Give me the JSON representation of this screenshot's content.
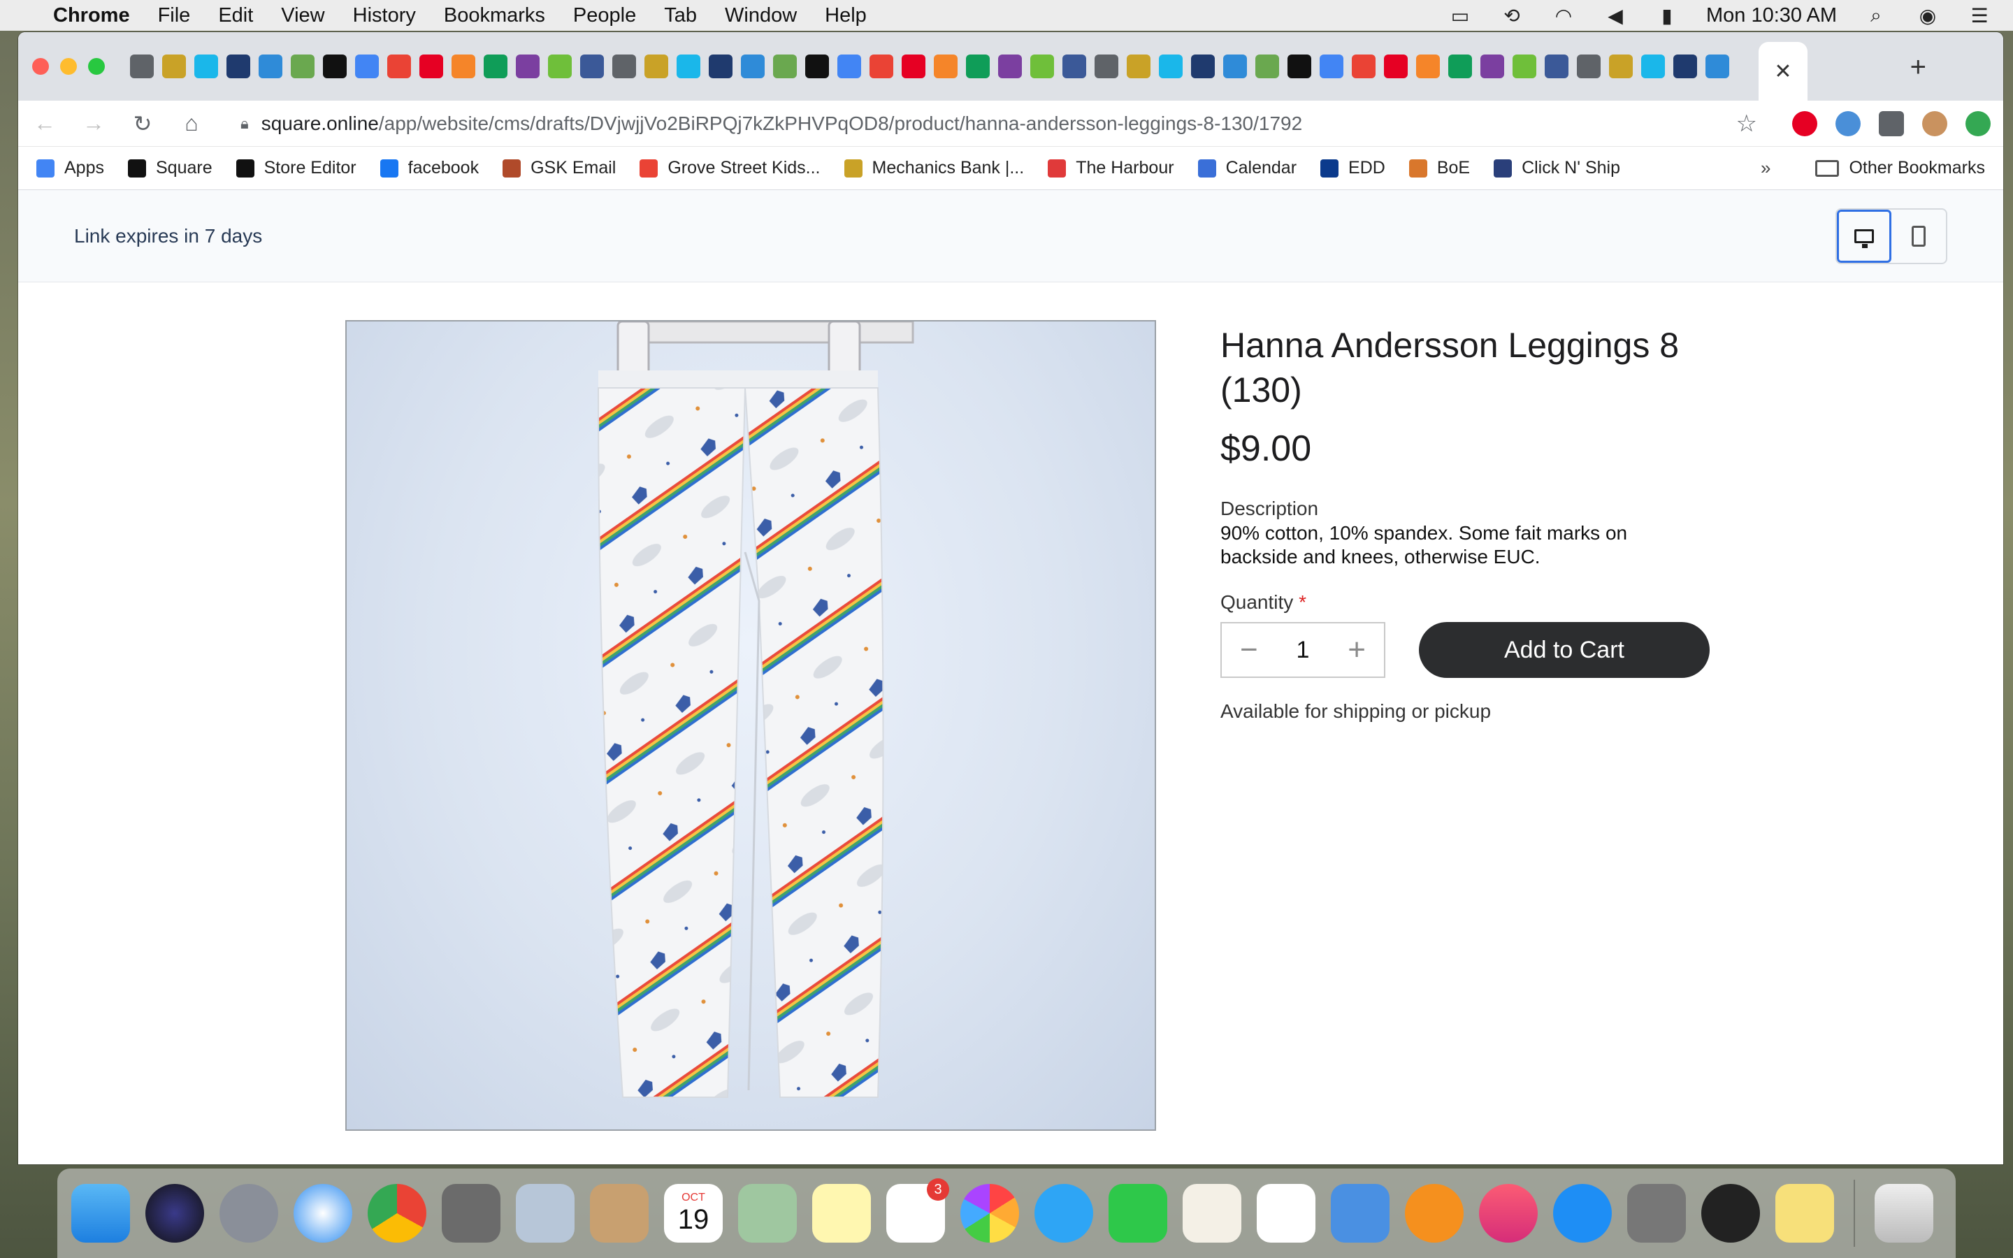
{
  "menubar": {
    "app": "Chrome",
    "items": [
      "File",
      "Edit",
      "View",
      "History",
      "Bookmarks",
      "People",
      "Tab",
      "Window",
      "Help"
    ],
    "clock": "Mon 10:30 AM"
  },
  "browser": {
    "tab_favicons": [
      "globe",
      "globe",
      "globe",
      "hub.",
      "globe",
      "mechanics-bank",
      "mechanics-bank",
      "vimeo",
      "sba",
      "hex",
      "leaf",
      "LB",
      "diamond",
      "bunny",
      "Z",
      "square-color",
      "home-depot",
      "isi",
      "pinterest",
      "instagram",
      "google",
      "sf",
      "sf",
      "pinterest",
      "photo",
      "square-color",
      "square-color",
      "square-color",
      "dots",
      "dots",
      "UN",
      "google",
      "houzz",
      "houzz",
      "houzz",
      "houzz",
      "houzz",
      "google",
      "square-color",
      "swirl",
      "sba",
      "sba",
      "sba",
      "sba",
      "globe",
      "X",
      "shell",
      "square",
      "square",
      "google"
    ],
    "url_host": "square.online",
    "url_path": "/app/website/cms/drafts/DVjwjjVo2BiRPQj7kZkPHVPqOD8/product/hanna-andersson-leggings-8-130/1792",
    "bookmarks": [
      {
        "label": "Apps",
        "color": "#4285f4"
      },
      {
        "label": "Square",
        "color": "#111111"
      },
      {
        "label": "Store Editor",
        "color": "#111111"
      },
      {
        "label": "facebook",
        "color": "#1877f2"
      },
      {
        "label": "GSK Email",
        "color": "#b04a2a"
      },
      {
        "label": "Grove Street Kids...",
        "color": "#ea4335"
      },
      {
        "label": "Mechanics Bank |...",
        "color": "#c9a227"
      },
      {
        "label": "The Harbour",
        "color": "#e03a3a"
      },
      {
        "label": "Calendar",
        "color": "#3a6fd8"
      },
      {
        "label": "EDD",
        "color": "#0b3a8c"
      },
      {
        "label": "BoE",
        "color": "#d9772c"
      },
      {
        "label": "Click N' Ship",
        "color": "#2a3f7a"
      }
    ],
    "bookmarks_more": "»",
    "other_bookmarks": "Other Bookmarks"
  },
  "page": {
    "link_expiry": "Link expires in 7 days",
    "product": {
      "title": "Hanna Andersson Leggings 8 (130)",
      "price": "$9.00",
      "description_label": "Description",
      "description": "90% cotton, 10% spandex. Some fait marks on backside and knees, otherwise EUC.",
      "quantity_label": "Quantity",
      "quantity_required": "*",
      "quantity_value": "1",
      "decrement": "−",
      "increment": "+",
      "add_to_cart": "Add to Cart",
      "availability": "Available for shipping or pickup"
    }
  },
  "dock": {
    "calendar_month": "OCT",
    "calendar_day": "19",
    "reminders_badge": "3"
  },
  "colors": {
    "accent_blue": "#2f6fe4",
    "cart_button": "#2c2d2f",
    "required": "#dd2222"
  }
}
